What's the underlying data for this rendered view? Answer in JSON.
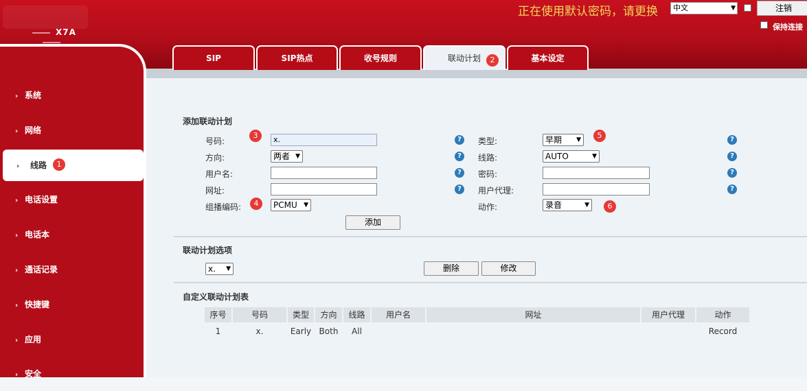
{
  "header": {
    "model": "X7A",
    "warning": "正在使用默认密码，请更换",
    "language": "中文",
    "logout_label": "注销",
    "keep_connected_label": "保持连接"
  },
  "tabs": [
    {
      "label": "SIP"
    },
    {
      "label": "SIP热点"
    },
    {
      "label": "收号规则"
    },
    {
      "label": "联动计划"
    },
    {
      "label": "基本设定"
    }
  ],
  "sidebar": {
    "items": [
      {
        "label": "系统"
      },
      {
        "label": "网络"
      },
      {
        "label": "线路"
      },
      {
        "label": "电话设置"
      },
      {
        "label": "电话本"
      },
      {
        "label": "通话记录"
      },
      {
        "label": "快捷键"
      },
      {
        "label": "应用"
      },
      {
        "label": "安全"
      }
    ]
  },
  "badges": [
    "1",
    "2",
    "3",
    "4",
    "5",
    "6"
  ],
  "add_plan": {
    "title": "添加联动计划",
    "number_label": "号码:",
    "number_value": "x.",
    "direction_label": "方向:",
    "direction_value": "两者",
    "username_label": "用户名:",
    "url_label": "网址:",
    "codec_label": "组播编码:",
    "codec_value": "PCMU",
    "type_label": "类型:",
    "type_value": "早期",
    "line_label": "线路:",
    "line_value": "AUTO",
    "password_label": "密码:",
    "useragent_label": "用户代理:",
    "action_label": "动作:",
    "action_value": "录音",
    "add_button": "添加",
    "help_glyph": "?"
  },
  "plan_options": {
    "title": "联动计划选项",
    "selected": "x.",
    "delete_button": "删除",
    "modify_button": "修改"
  },
  "custom_table": {
    "title": "自定义联动计划表",
    "columns": [
      "序号",
      "号码",
      "类型",
      "方向",
      "线路",
      "用户名",
      "网址",
      "用户代理",
      "动作"
    ],
    "rows": [
      [
        "1",
        "x.",
        "Early",
        "Both",
        "All",
        "",
        "",
        "",
        "Record"
      ]
    ]
  },
  "colors": {
    "brand_red": "#b30d1a",
    "warning_text": "#f2d45a",
    "help_blue": "#2d7ab8",
    "badge_red": "#e53935"
  },
  "icons": {
    "sidebar_chevron": "›",
    "select_arrow": "▼"
  }
}
